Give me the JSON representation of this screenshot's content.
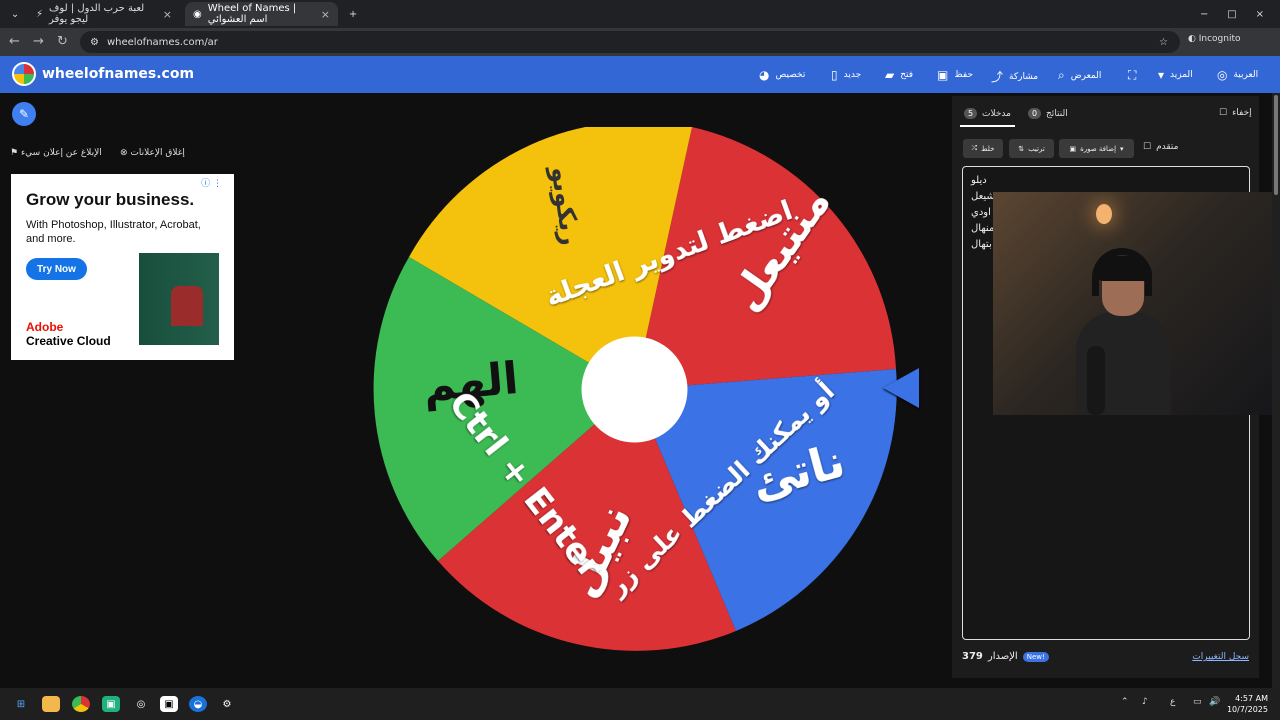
{
  "browser": {
    "tabs": [
      {
        "label": "لعبة حرب الدول | لوف ليجو يوفر",
        "active": false
      },
      {
        "label": "Wheel of Names | اسم العشوائي",
        "active": true
      }
    ],
    "url": "wheelofnames.com/ar",
    "incognito_label": "Incognito",
    "new_tab": "+"
  },
  "app": {
    "brand": "wheelofnames.com",
    "menu": [
      "العربية",
      "المزيد",
      "المعرض",
      "مشاركة",
      "حفظ",
      "فتح",
      "جديد",
      "تخصيص"
    ]
  },
  "ads": {
    "close_ads": "إغلاق الإعلانات",
    "report_ad": "الإبلاغ عن إعلان سيء",
    "headline": "Grow your business.",
    "body": "With Photoshop, Illustrator, Acrobat, and more.",
    "cta": "Try Now",
    "adobe": "Adobe",
    "cc": "Creative Cloud"
  },
  "wheel": {
    "center_text_1": "اضغط لتدوير العجلة",
    "center_text_2": "أو يمكنك الضغط على زر",
    "shortcut": "Ctrl + Enter",
    "slices": [
      {
        "label": "منتيعل",
        "color": "#db3236"
      },
      {
        "label": "ريكويو",
        "color": "#f4c20d"
      },
      {
        "label": "الهم",
        "color": "#3cba54"
      },
      {
        "label": "نبيل",
        "color": "#db3236"
      },
      {
        "label": "ناتئ",
        "color": "#3b72e5"
      }
    ]
  },
  "panel": {
    "hide": "إخفاء",
    "results": "النتائج",
    "results_count": "0",
    "entries": "مدخلات",
    "entries_count": "5",
    "shuffle": "خلط",
    "sort": "ترتيب",
    "add_image": "إضافة صورة",
    "advanced": "متقدم",
    "items": [
      "ديلو",
      "شيعل",
      "اودي",
      "منهال",
      "بتهال"
    ],
    "version_label": "الإصدار",
    "version": "379",
    "new": "New!",
    "changelog": "سجل التغييرات"
  },
  "taskbar": {
    "time": "4:57 AM",
    "date": "10/7/2025",
    "lang": "ع"
  }
}
